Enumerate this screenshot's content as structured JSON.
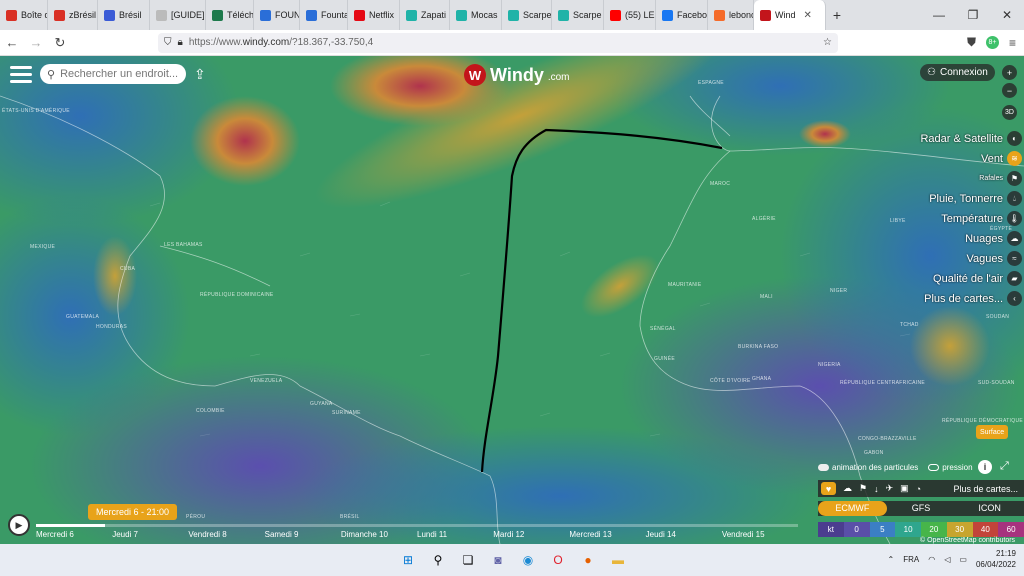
{
  "browser": {
    "tabs": [
      {
        "label": "Boîte d",
        "icon": "gmail-icon",
        "color": "#d93025"
      },
      {
        "label": "zBrésil",
        "icon": "gmail-icon",
        "color": "#d93025"
      },
      {
        "label": "Brésil",
        "icon": "site-icon",
        "color": "#3b5bd6"
      },
      {
        "label": "[GUIDE] L'o",
        "icon": "blank-page-icon",
        "color": "#bbbbbb"
      },
      {
        "label": "Téléch",
        "icon": "site-icon",
        "color": "#1e7a4c"
      },
      {
        "label": "FOUNT",
        "icon": "site-icon",
        "color": "#2a6ed8"
      },
      {
        "label": "Founta",
        "icon": "site-icon",
        "color": "#2a6ed8"
      },
      {
        "label": "Netflix",
        "icon": "netflix-icon",
        "color": "#e50914"
      },
      {
        "label": "Zapati",
        "icon": "v-icon",
        "color": "#20b3a8"
      },
      {
        "label": "Mocas",
        "icon": "v-icon",
        "color": "#20b3a8"
      },
      {
        "label": "Scarpe",
        "icon": "v-icon",
        "color": "#20b3a8"
      },
      {
        "label": "Scarpe",
        "icon": "v-icon",
        "color": "#20b3a8"
      },
      {
        "label": "(55) LE",
        "icon": "youtube-icon",
        "color": "#ff0000"
      },
      {
        "label": "Facebo",
        "icon": "facebook-icon",
        "color": "#1877f2"
      },
      {
        "label": "lebonc",
        "icon": "leboncoin-icon",
        "color": "#f56b2a"
      },
      {
        "label": "Wind",
        "icon": "windy-icon",
        "color": "#c3151b",
        "active": true
      }
    ],
    "new_tab": "+",
    "url_prefix": "https://www.",
    "url_domain": "windy.com",
    "url_path": "/?18.367,-33.750,4",
    "ext_badge": "8+"
  },
  "windy": {
    "search_placeholder": "Rechercher un endroit...",
    "logo_text": "Windy",
    "logo_domain": ".com",
    "login": "Connexion",
    "zoom_in": "+",
    "zoom_out": "−",
    "view_3d": "3D",
    "layers": [
      {
        "label": "Radar & Satellite",
        "icon": "radar-icon",
        "small": false,
        "active": false
      },
      {
        "label": "Vent",
        "icon": "wind-icon",
        "small": false,
        "active": true
      },
      {
        "label": "Rafales",
        "icon": "gust-flag-icon",
        "small": true,
        "active": false
      },
      {
        "label": "Pluie, Tonnerre",
        "icon": "rain-drop-icon",
        "small": false,
        "active": false
      },
      {
        "label": "Température",
        "icon": "thermometer-icon",
        "small": false,
        "active": false
      },
      {
        "label": "Nuages",
        "icon": "cloud-icon",
        "small": false,
        "active": false
      },
      {
        "label": "Vagues",
        "icon": "waves-icon",
        "small": false,
        "active": false
      },
      {
        "label": "Qualité de l'air",
        "icon": "car-icon",
        "small": false,
        "active": false
      },
      {
        "label": "Plus de cartes...",
        "icon": "chevron-left-icon",
        "small": false,
        "active": false
      }
    ],
    "surface": "Surface",
    "anim_particles": "animation des particules",
    "pressure": "pression",
    "more_layers": "Plus de cartes...",
    "models": [
      {
        "label": "ECMWF",
        "active": true
      },
      {
        "label": "GFS",
        "active": false
      },
      {
        "label": "ICON",
        "active": false
      }
    ],
    "scale_unit": "kt",
    "scale_values": [
      "0",
      "5",
      "10",
      "20",
      "30",
      "40",
      "60"
    ],
    "scale_colors": [
      "#5a4fa8",
      "#3b7fc4",
      "#2fa68e",
      "#47b54a",
      "#c7a52f",
      "#c2443a",
      "#a6327e"
    ],
    "attribution": "© OpenStreetMap contributors",
    "current_time": "Mercredi 6 - 21:00",
    "timeline_progress": 0.09,
    "days": [
      "Mercredi 6",
      "Jeudi 7",
      "Vendredi 8",
      "Samedi 9",
      "Dimanche 10",
      "Lundi 11",
      "Mardi 12",
      "Mercredi 13",
      "Jeudi 14",
      "Vendredi 15"
    ],
    "map_labels": [
      "ÉTATS-UNIS D'AMÉRIQUE",
      "ESPAGNE",
      "MAROC",
      "ALGÉRIE",
      "LIBYE",
      "ÉGYPTE",
      "MAURITANIE",
      "MALI",
      "NIGER",
      "TCHAD",
      "SOUDAN",
      "SÉNÉGAL",
      "GUINÉE",
      "BURKINA FASO",
      "CÔTE D'IVOIRE",
      "GHANA",
      "NIGERIA",
      "RÉPUBLIQUE CENTRAFRICAINE",
      "SUD-SOUDAN",
      "CONGO-BRAZZAVILLE",
      "RÉPUBLIQUE DÉMOCRATIQUE DU CONGO",
      "GABON",
      "LES BAHAMAS",
      "RÉPUBLIQUE DOMINICAINE",
      "HONDURAS",
      "GUATEMALA",
      "VENEZUELA",
      "COLOMBIE",
      "GUYANA",
      "SURINAME",
      "BRÉSIL",
      "PÉROU",
      "CUBA",
      "MEXIQUE"
    ]
  },
  "taskbar": {
    "lang": "FRA",
    "time": "21:19",
    "date": "06/04/2022"
  }
}
